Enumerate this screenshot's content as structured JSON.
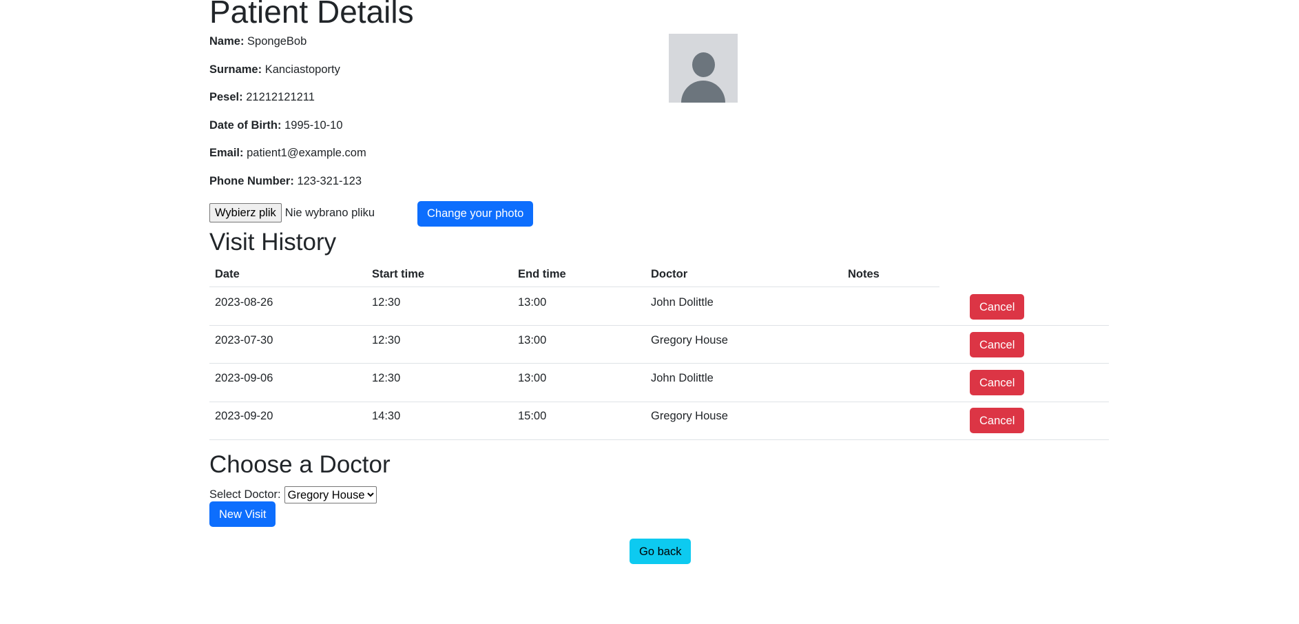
{
  "page_title": "Patient Details",
  "patient": {
    "name_label": "Name:",
    "name": "SpongeBob",
    "surname_label": "Surname:",
    "surname": "Kanciastoporty",
    "pesel_label": "Pesel:",
    "pesel": "21212121211",
    "dob_label": "Date of Birth:",
    "dob": "1995-10-10",
    "email_label": "Email:",
    "email": "patient1@example.com",
    "phone_label": "Phone Number:",
    "phone": "123-321-123"
  },
  "photo": {
    "avatar_icon": "user-silhouette-icon",
    "file_button_label": "Wybierz plik",
    "file_status": "Nie wybrano pliku",
    "change_button_label": "Change your photo"
  },
  "visit_history": {
    "title": "Visit History",
    "columns": [
      "Date",
      "Start time",
      "End time",
      "Doctor",
      "Notes"
    ],
    "rows": [
      {
        "date": "2023-08-26",
        "start": "12:30",
        "end": "13:00",
        "doctor": "John Dolittle",
        "notes": "",
        "action": "Cancel"
      },
      {
        "date": "2023-07-30",
        "start": "12:30",
        "end": "13:00",
        "doctor": "Gregory House",
        "notes": "",
        "action": "Cancel"
      },
      {
        "date": "2023-09-06",
        "start": "12:30",
        "end": "13:00",
        "doctor": "John Dolittle",
        "notes": "",
        "action": "Cancel"
      },
      {
        "date": "2023-09-20",
        "start": "14:30",
        "end": "15:00",
        "doctor": "Gregory House",
        "notes": "",
        "action": "Cancel"
      }
    ]
  },
  "choose_doctor": {
    "title": "Choose a Doctor",
    "select_label": "Select Doctor:",
    "selected": "Gregory House",
    "new_visit_label": "New Visit"
  },
  "go_back_label": "Go back",
  "colors": {
    "primary": "#0d6efd",
    "danger": "#dc3545",
    "info": "#0dcaf0",
    "text": "#212529",
    "border": "#dee2e6"
  }
}
